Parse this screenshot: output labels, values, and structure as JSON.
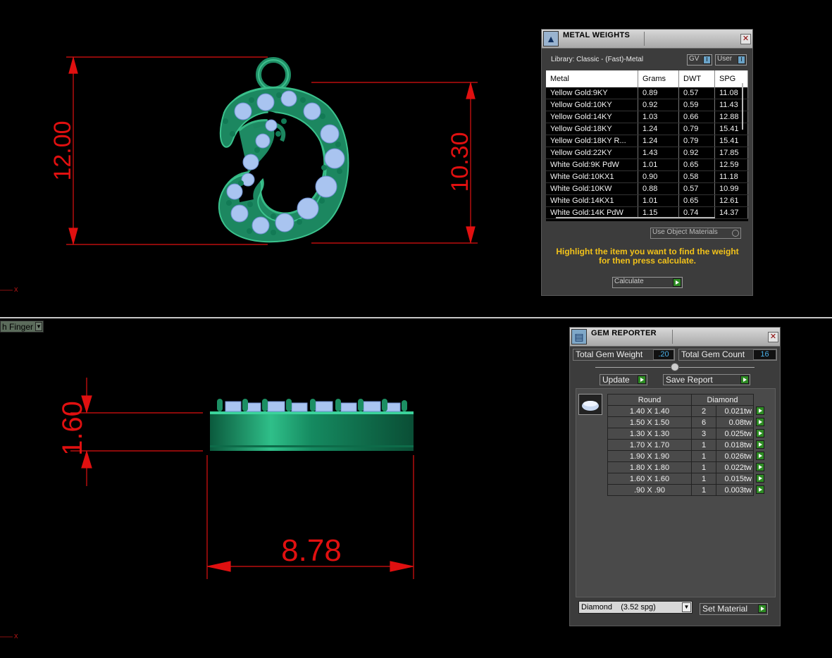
{
  "viewports": {
    "top": {
      "dimension_height": "12.00",
      "dimension_inner_height": "10.30",
      "axis_label": "x"
    },
    "bottom": {
      "view_select_label": "h Finger",
      "dimension_thickness": "1.60",
      "dimension_width": "8.78",
      "axis_label": "x"
    }
  },
  "colors": {
    "dimension_red": "#e01010",
    "model_green": "#1f9b6e",
    "gem_blue": "#a9c4f0",
    "hint_yellow": "#f2c21a",
    "go_green": "#2e8b24"
  },
  "metal_weights": {
    "title": "METAL WEIGHTS",
    "library": "Library: Classic - (Fast)-Metal",
    "toggle_gv": "GV",
    "toggle_user": "User",
    "columns": [
      "Metal",
      "Grams",
      "DWT",
      "SPG"
    ],
    "rows": [
      [
        "Yellow Gold:9KY",
        "0.89",
        "0.57",
        "11.08"
      ],
      [
        "Yellow Gold:10KY",
        "0.92",
        "0.59",
        "11.43"
      ],
      [
        "Yellow Gold:14KY",
        "1.03",
        "0.66",
        "12.88"
      ],
      [
        "Yellow Gold:18KY",
        "1.24",
        "0.79",
        "15.41"
      ],
      [
        "Yellow Gold:18KY R...",
        "1.24",
        "0.79",
        "15.41"
      ],
      [
        "Yellow Gold:22KY",
        "1.43",
        "0.92",
        "17.85"
      ],
      [
        "White Gold:9K PdW",
        "1.01",
        "0.65",
        "12.59"
      ],
      [
        "White Gold:10KX1",
        "0.90",
        "0.58",
        "11.18"
      ],
      [
        "White Gold:10KW",
        "0.88",
        "0.57",
        "10.99"
      ],
      [
        "White Gold:14KX1",
        "1.01",
        "0.65",
        "12.61"
      ],
      [
        "White Gold:14K PdW",
        "1.15",
        "0.74",
        "14.37"
      ]
    ],
    "use_object_materials": "Use Object Materials",
    "hint_line1": "Highlight the item you want to find the weight",
    "hint_line2": "for then press calculate.",
    "calculate_label": "Calculate"
  },
  "gem_reporter": {
    "title": "GEM REPORTER",
    "total_weight_label": "Total Gem Weight",
    "total_weight_value": ".20",
    "total_count_label": "Total Gem Count",
    "total_count_value": "16",
    "update_label": "Update",
    "save_report_label": "Save Report",
    "column_shape": "Round",
    "column_material": "Diamond",
    "rows": [
      {
        "size": "1.40 X 1.40",
        "count": "2",
        "weight": "0.021tw"
      },
      {
        "size": "1.50 X 1.50",
        "count": "6",
        "weight": "0.08tw"
      },
      {
        "size": "1.30 X 1.30",
        "count": "3",
        "weight": "0.025tw"
      },
      {
        "size": "1.70 X 1.70",
        "count": "1",
        "weight": "0.018tw"
      },
      {
        "size": "1.90 X 1.90",
        "count": "1",
        "weight": "0.026tw"
      },
      {
        "size": "1.80 X 1.80",
        "count": "1",
        "weight": "0.022tw"
      },
      {
        "size": "1.60 X 1.60",
        "count": "1",
        "weight": "0.015tw"
      },
      {
        "size": ".90 X .90",
        "count": "1",
        "weight": "0.003tw"
      }
    ],
    "material_select": "Diamond    (3.52 spg)",
    "set_material_label": "Set Material"
  }
}
